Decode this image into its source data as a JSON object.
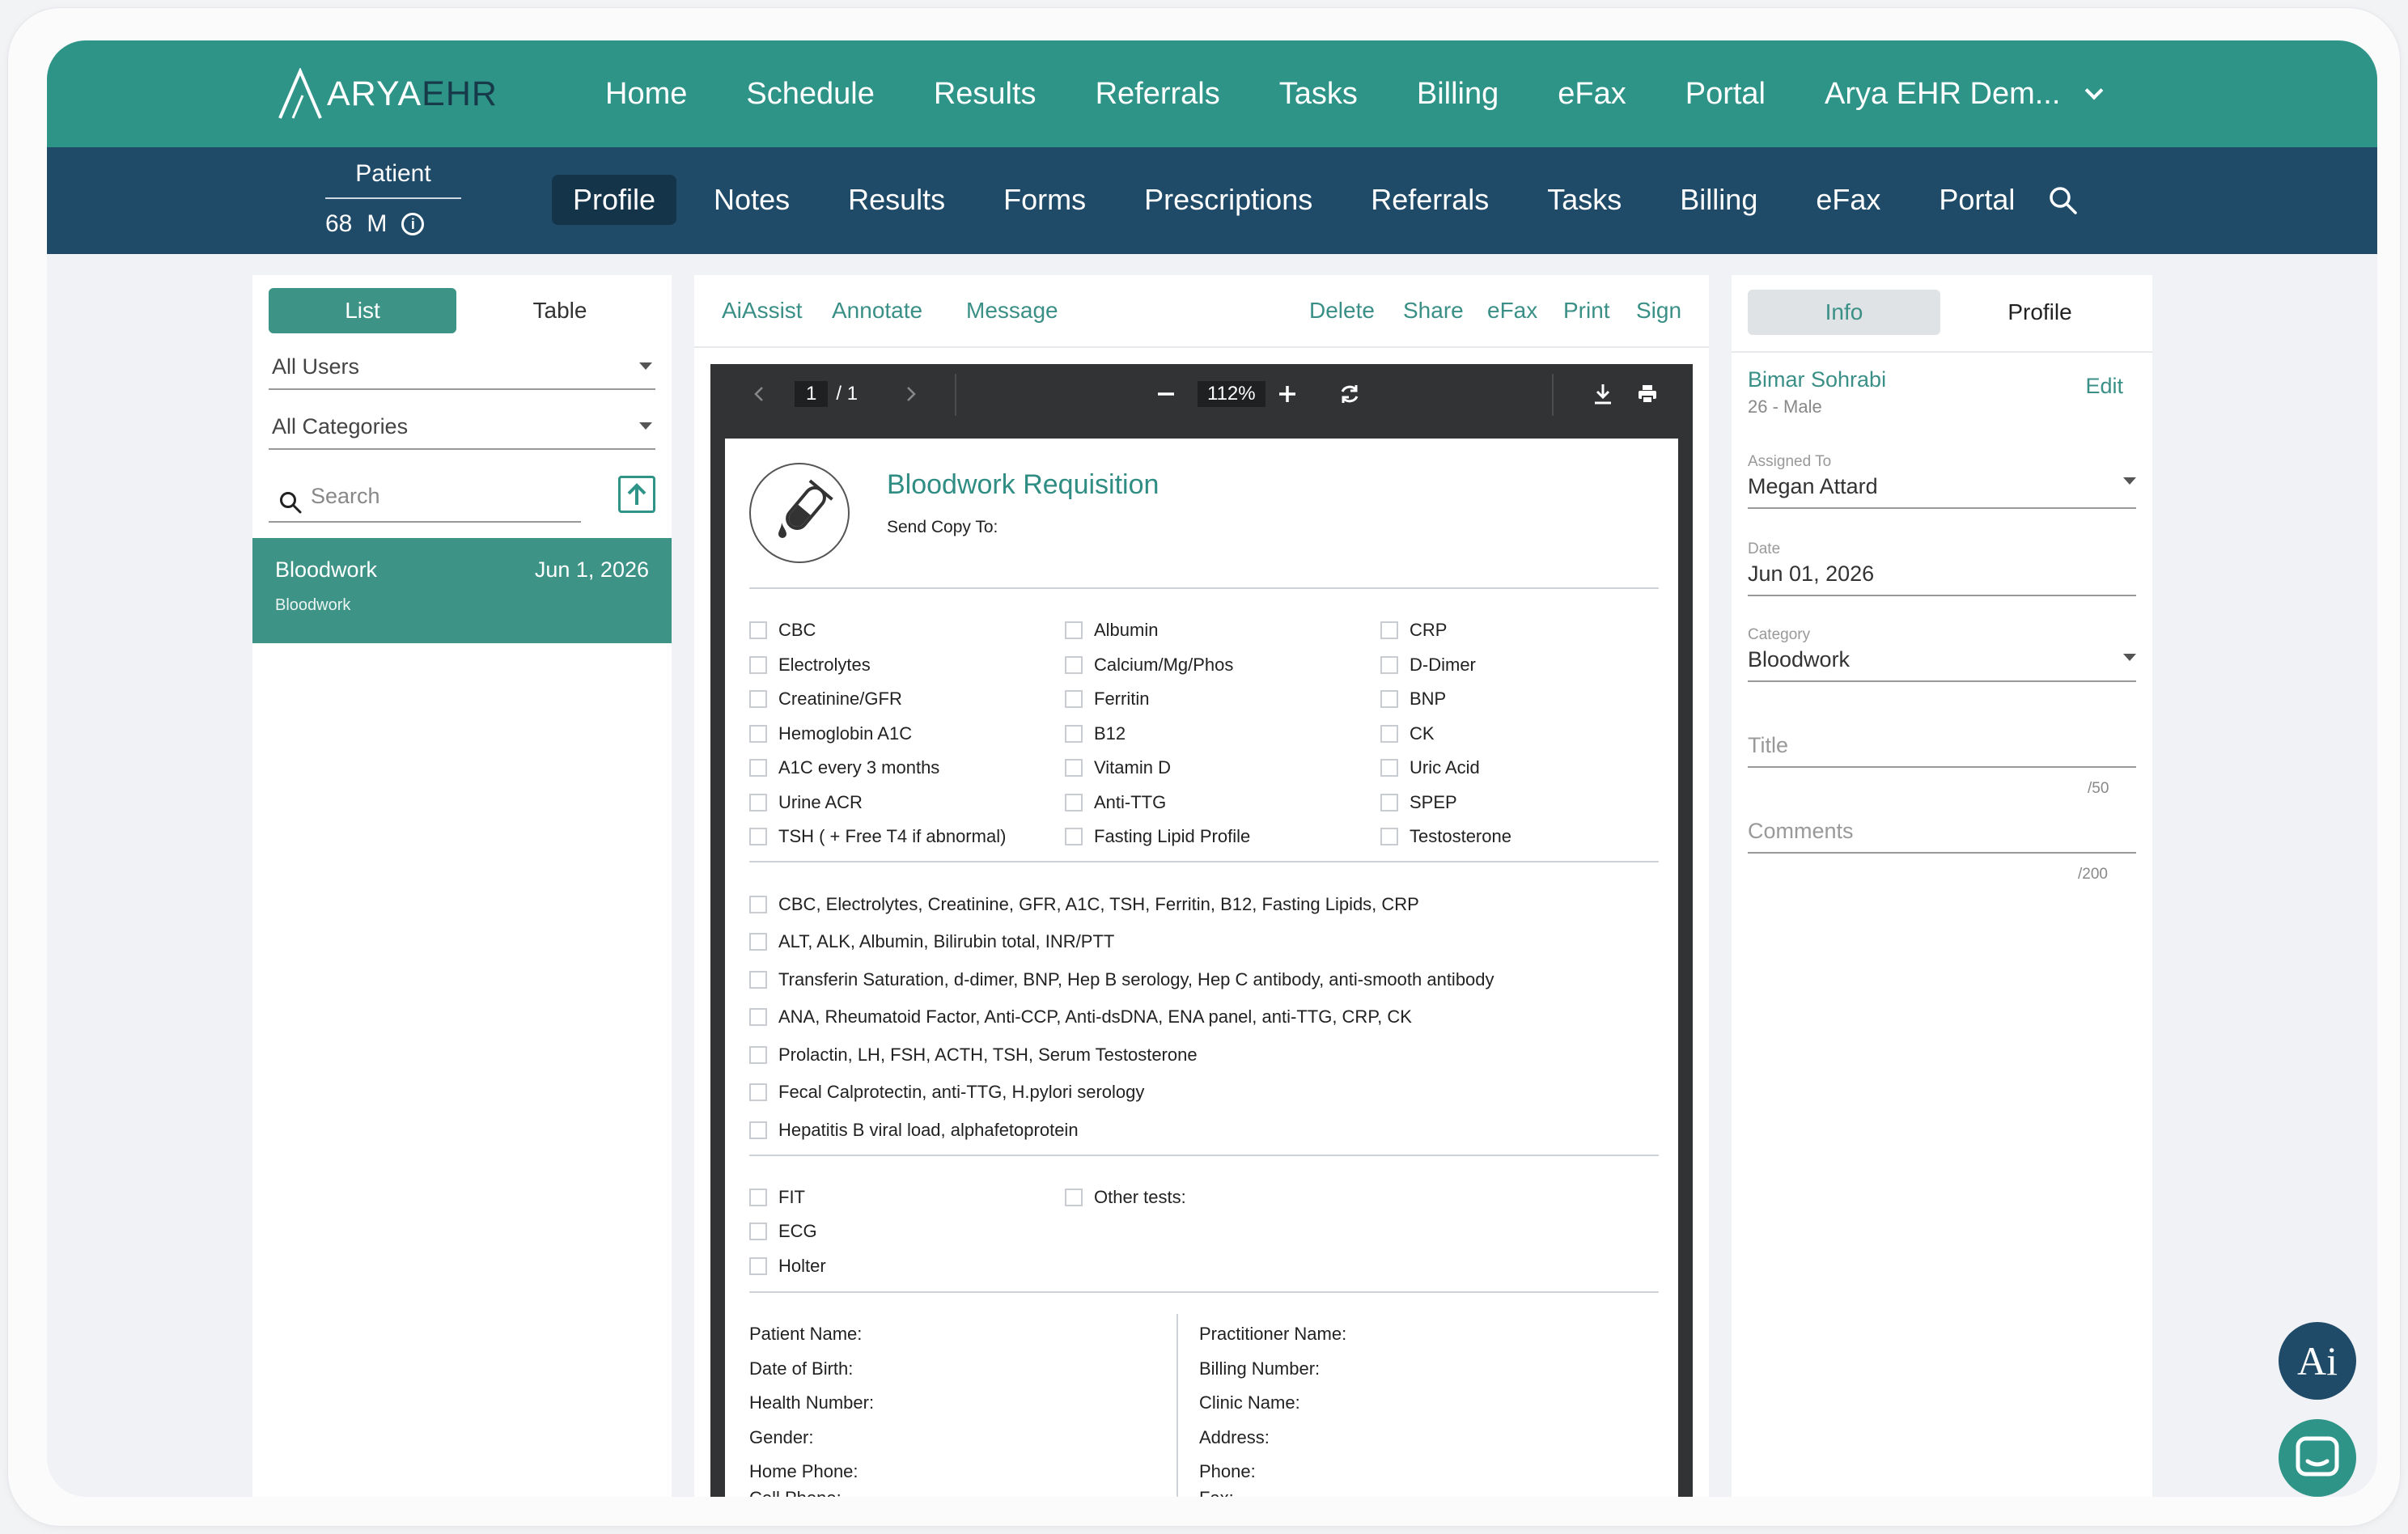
{
  "app": {
    "brand": "ARYA",
    "brand_suffix": "EHR",
    "top_nav": [
      "Home",
      "Schedule",
      "Results",
      "Referrals",
      "Tasks",
      "Billing",
      "eFax",
      "Portal",
      "Arya EHR Dem..."
    ]
  },
  "patient": {
    "label": "Patient",
    "age": "68",
    "sex": "M"
  },
  "sub_nav": {
    "items": [
      "Profile",
      "Notes",
      "Results",
      "Forms",
      "Prescriptions",
      "Referrals",
      "Tasks",
      "Billing",
      "eFax",
      "Portal"
    ],
    "active": "Profile"
  },
  "left": {
    "toggle": [
      "List",
      "Table"
    ],
    "user_filter": "All Users",
    "category_filter": "All Categories",
    "search_placeholder": "Search",
    "items": [
      {
        "name": "Bloodwork",
        "date": "Jun 1, 2026",
        "category": "Bloodwork"
      }
    ]
  },
  "toolbar": {
    "left": [
      "AiAssist",
      "Annotate",
      "Message"
    ],
    "right": [
      "Delete",
      "Share",
      "eFax",
      "Print",
      "Sign"
    ]
  },
  "viewer": {
    "page": "1",
    "page_total": "/  1",
    "zoom": "112%"
  },
  "document": {
    "title": "Bloodwork Requisition",
    "send_copy": "Send Copy To:",
    "tests_col1": [
      "CBC",
      "Electrolytes",
      "Creatinine/GFR",
      "Hemoglobin A1C",
      "A1C every 3 months",
      "Urine ACR",
      "TSH ( + Free T4 if abnormal)"
    ],
    "tests_col2": [
      "Albumin",
      "Calcium/Mg/Phos",
      "Ferritin",
      "B12",
      "Vitamin D",
      "Anti-TTG",
      "Fasting Lipid Profile"
    ],
    "tests_col3": [
      "CRP",
      "D-Dimer",
      "BNP",
      "CK",
      "Uric Acid",
      "SPEP",
      "Testosterone"
    ],
    "panels": [
      "CBC, Electrolytes, Creatinine, GFR, A1C, TSH, Ferritin, B12, Fasting Lipids, CRP",
      "ALT, ALK, Albumin, Bilirubin total, INR/PTT",
      "Transferin Saturation, d-dimer, BNP, Hep B serology, Hep C antibody, anti-smooth antibody",
      "ANA, Rheumatoid Factor, Anti-CCP, Anti-dsDNA, ENA panel, anti-TTG, CRP, CK",
      "Prolactin, LH, FSH, ACTH, TSH, Serum Testosterone",
      "Fecal Calprotectin, anti-TTG, H.pylori serology",
      "Hepatitis B viral load, alphafetoprotein"
    ],
    "other_col1": [
      "FIT",
      "ECG",
      "Holter"
    ],
    "other_tests": "Other tests:",
    "patient_fields": [
      "Patient Name:",
      "Date of Birth:",
      "Health Number:",
      "Gender:",
      "Home Phone:",
      "Cell Phone:"
    ],
    "practitioner_fields": [
      "Practitioner Name:",
      "Billing Number:",
      "Clinic Name:",
      "Address:",
      "Phone:",
      "Fax:"
    ]
  },
  "right": {
    "toggle": [
      "Info",
      "Profile"
    ],
    "patient_name": "Bimar Sohrabi",
    "patient_demo": "26 - Male",
    "edit": "Edit",
    "assigned_label": "Assigned To",
    "assigned_value": "Megan Attard",
    "date_label": "Date",
    "date_value": "Jun 01, 2026",
    "category_label": "Category",
    "category_value": "Bloodwork",
    "title_placeholder": "Title",
    "title_counter": "/50",
    "comments_placeholder": "Comments",
    "comments_counter": "/200"
  },
  "fabs": {
    "ai_label": "Ai"
  },
  "colors": {
    "primary": "#2f9488",
    "navy": "#1f4b68",
    "viewer": "#313335"
  }
}
